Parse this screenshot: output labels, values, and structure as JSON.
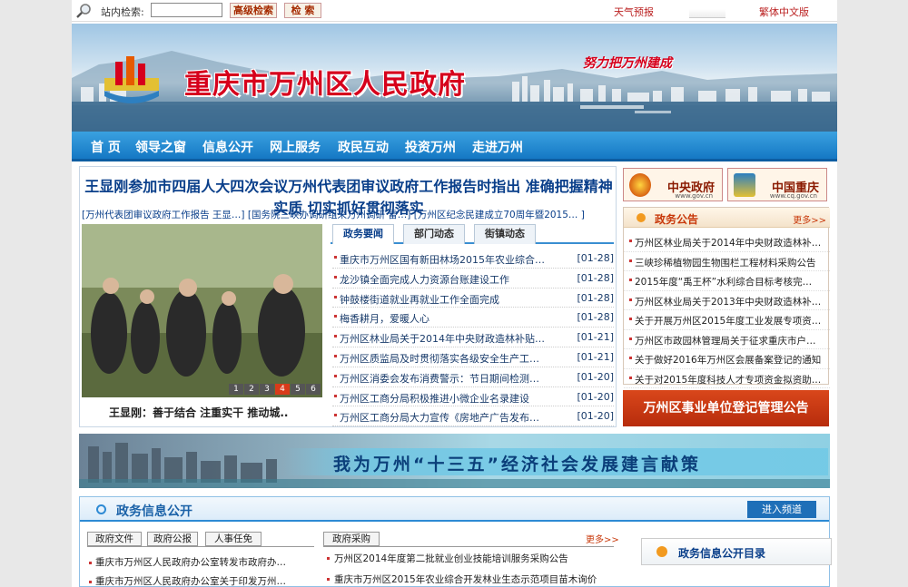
{
  "topbar": {
    "search_label": "站内检索:",
    "search_value": "",
    "advanced_search": "高级检索",
    "search_button": "检  索",
    "weather": "天气预报",
    "traditional": "繁体中文版"
  },
  "banner": {
    "title": "重庆市万州区人民政府",
    "slogan": "努力把万州建成"
  },
  "nav": {
    "items": [
      "首 页",
      "领导之窗",
      "信息公开",
      "网上服务",
      "政民互动",
      "投资万州",
      "走进万州"
    ]
  },
  "main": {
    "headline": "王显刚参加市四届人大四次会议万州代表团审议政府工作报告时指出 准确把握精神实质 切实抓好贯彻落实",
    "subheadlines": "[万州代表团审议政府工作报告 王显…] [国务院三峡办调研组来万州调研 雷…] [万州区纪念民建成立70周年暨2015… ]",
    "photo_caption": "王显刚：善于结合 注重实干 推动城..",
    "photo_pages": [
      "1",
      "2",
      "3",
      "4",
      "5",
      "6"
    ],
    "photo_active": "4",
    "tabs": [
      "政务要闻",
      "部门动态",
      "街镇动态"
    ],
    "news": [
      {
        "title": "重庆市万州区国有新田林场2015年农业综合…",
        "date": "[01-28]"
      },
      {
        "title": "龙沙镇全面完成人力资源台账建设工作",
        "date": "[01-28]"
      },
      {
        "title": "钟鼓楼街道就业再就业工作全面完成",
        "date": "[01-28]"
      },
      {
        "title": "梅香耕月，爱暖人心",
        "date": "[01-28]"
      },
      {
        "title": "万州区林业局关于2014年中央财政造林补贴…",
        "date": "[01-21]"
      },
      {
        "title": "万州区质监局及时贯彻落实各级安全生产工…",
        "date": "[01-21]"
      },
      {
        "title": "万州区消委会发布消费警示：节日期间检测…",
        "date": "[01-20]"
      },
      {
        "title": "万州区工商分局积极推进小微企业名录建设",
        "date": "[01-20]"
      },
      {
        "title": "万州区工商分局大力宣传《房地产广告发布…",
        "date": "[01-20]"
      }
    ]
  },
  "logos": {
    "central": {
      "name": "中央政府",
      "url": "www.gov.cn"
    },
    "chongqing": {
      "name": "中国重庆",
      "url": "www.cq.gov.cn"
    }
  },
  "notice": {
    "title": "政务公告",
    "more": "更多>>",
    "items": [
      "万州区林业局关于2014年中央财政造林补…",
      "三峡珍稀植物园生物围栏工程材料采购公告",
      "2015年度“禹王杯”水利综合目标考核完…",
      "万州区林业局关于2013年中央财政造林补…",
      "关于开展万州区2015年度工业发展专项资…",
      "万州区市政园林管理局关于征求重庆市户…",
      "关于做好2016年万州区会展备案登记的通知",
      "关于对2015年度科技人才专项资金拟资助…"
    ],
    "register_banner": "万州区事业单位登记管理公告"
  },
  "strip": {
    "text": "我为万州“十三五”经济社会发展建言献策"
  },
  "section": {
    "title": "政务信息公开",
    "enter_button": "进入频道",
    "left_tabs": [
      "政府文件",
      "政府公报",
      "人事任免"
    ],
    "left_items": [
      "重庆市万州区人民政府办公室转发市政府办…",
      "重庆市万州区人民政府办公室关于印发万州…"
    ],
    "mid_tab": "政府采购",
    "mid_more": "更多>>",
    "mid_items": [
      "万州区2014年度第二批就业创业技能培训服务采购公告",
      "重庆市万州区2015年农业综合开发林业生态示范项目苗木询价…"
    ],
    "catalog_title": "政务信息公开目录"
  },
  "colors": {
    "nav_blue": "#1578c4",
    "title_blue": "#0a3f8a",
    "accent_red": "#c8380a",
    "banner_red": "#d6001c"
  }
}
